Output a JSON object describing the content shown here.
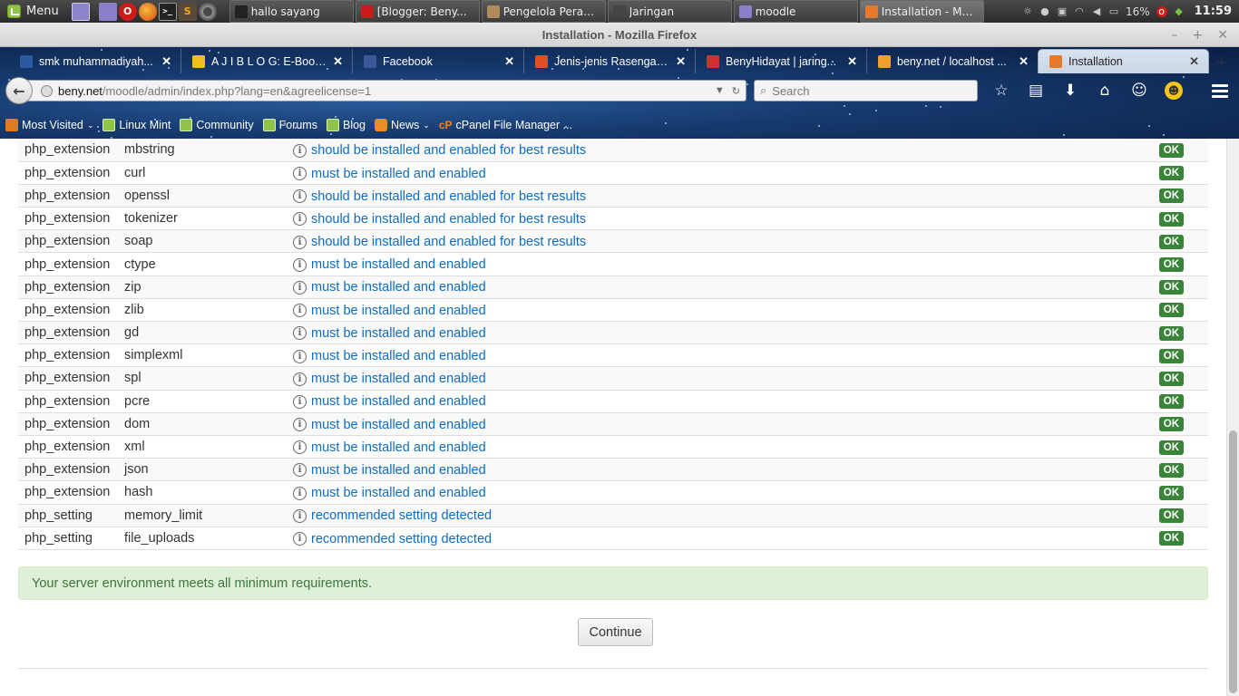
{
  "panel": {
    "menu_label": "Menu",
    "tasks": [
      {
        "label": "hallo sayang",
        "color": "#222222"
      },
      {
        "label": "[Blogger: Beny...",
        "color": "#cc1b1b"
      },
      {
        "label": "Pengelola Peran...",
        "color": "#b08a5a"
      },
      {
        "label": "Jaringan",
        "color": "#444444"
      },
      {
        "label": "moodle",
        "color": "#8c7fc9"
      },
      {
        "label": "Installation - Mo...",
        "color": "#e8782a"
      }
    ],
    "battery": "16%",
    "clock": "11:59"
  },
  "window": {
    "title": "Installation - Mozilla Firefox"
  },
  "tabs": [
    {
      "label": "smk muhammadiyah...",
      "color": "#2c5aa0"
    },
    {
      "label": "A J I B L O G: E-Book ...",
      "color": "#f0c020"
    },
    {
      "label": "Facebook",
      "color": "#3b5998"
    },
    {
      "label": "Jenis-jenis Rasengan!...",
      "color": "#e05020"
    },
    {
      "label": "BenyHidayat | jaring...",
      "color": "#d03030"
    },
    {
      "label": "beny.net / localhost ...",
      "color": "#f0a030"
    },
    {
      "label": "Installation",
      "color": "#e8782a",
      "selected": true
    }
  ],
  "navbar": {
    "url_host": "beny.net",
    "url_path": "/moodle/admin/index.php?lang=en&agreelicense=1",
    "search_placeholder": "Search"
  },
  "bookmarks": [
    {
      "label": "Most Visited",
      "icon": "mv",
      "dropdown": true
    },
    {
      "label": "Linux Mint",
      "icon": "mint"
    },
    {
      "label": "Community",
      "icon": "mint"
    },
    {
      "label": "Forums",
      "icon": "mint"
    },
    {
      "label": "Blog",
      "icon": "mint"
    },
    {
      "label": "News",
      "icon": "rss",
      "dropdown": true
    },
    {
      "label": "cPanel File Manager ...",
      "icon": "cp"
    }
  ],
  "environment": {
    "rows": [
      {
        "type": "php_extension",
        "name": "mbstring",
        "report": "should be installed and enabled for best results",
        "status": "OK"
      },
      {
        "type": "php_extension",
        "name": "curl",
        "report": "must be installed and enabled",
        "status": "OK"
      },
      {
        "type": "php_extension",
        "name": "openssl",
        "report": "should be installed and enabled for best results",
        "status": "OK"
      },
      {
        "type": "php_extension",
        "name": "tokenizer",
        "report": "should be installed and enabled for best results",
        "status": "OK"
      },
      {
        "type": "php_extension",
        "name": "soap",
        "report": "should be installed and enabled for best results",
        "status": "OK"
      },
      {
        "type": "php_extension",
        "name": "ctype",
        "report": "must be installed and enabled",
        "status": "OK"
      },
      {
        "type": "php_extension",
        "name": "zip",
        "report": "must be installed and enabled",
        "status": "OK"
      },
      {
        "type": "php_extension",
        "name": "zlib",
        "report": "must be installed and enabled",
        "status": "OK"
      },
      {
        "type": "php_extension",
        "name": "gd",
        "report": "must be installed and enabled",
        "status": "OK"
      },
      {
        "type": "php_extension",
        "name": "simplexml",
        "report": "must be installed and enabled",
        "status": "OK"
      },
      {
        "type": "php_extension",
        "name": "spl",
        "report": "must be installed and enabled",
        "status": "OK"
      },
      {
        "type": "php_extension",
        "name": "pcre",
        "report": "must be installed and enabled",
        "status": "OK"
      },
      {
        "type": "php_extension",
        "name": "dom",
        "report": "must be installed and enabled",
        "status": "OK"
      },
      {
        "type": "php_extension",
        "name": "xml",
        "report": "must be installed and enabled",
        "status": "OK"
      },
      {
        "type": "php_extension",
        "name": "json",
        "report": "must be installed and enabled",
        "status": "OK"
      },
      {
        "type": "php_extension",
        "name": "hash",
        "report": "must be installed and enabled",
        "status": "OK"
      },
      {
        "type": "php_setting",
        "name": "memory_limit",
        "report": "recommended setting detected",
        "status": "OK"
      },
      {
        "type": "php_setting",
        "name": "file_uploads",
        "report": "recommended setting detected",
        "status": "OK"
      }
    ],
    "summary": "Your server environment meets all minimum requirements.",
    "continue_label": "Continue"
  },
  "colors": {
    "link": "#0f6cbf",
    "ok_badge": "#398439",
    "success_bg": "#dff0d8",
    "success_text": "#3c763d"
  }
}
